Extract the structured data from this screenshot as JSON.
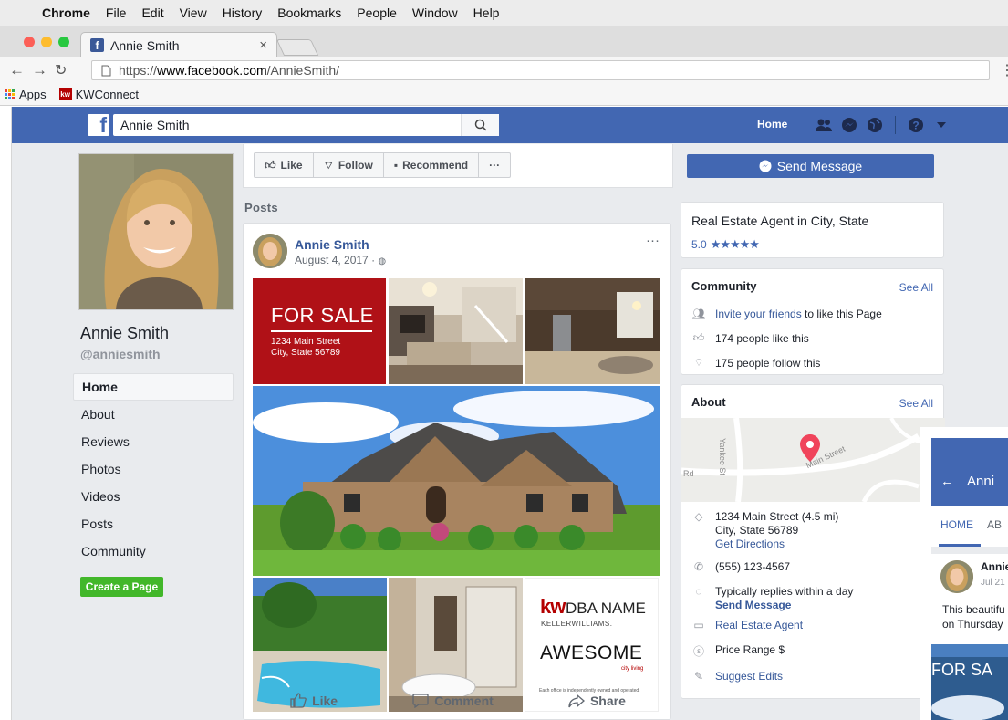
{
  "menubar": {
    "items": [
      "Chrome",
      "File",
      "Edit",
      "View",
      "History",
      "Bookmarks",
      "People",
      "Window",
      "Help"
    ]
  },
  "browser": {
    "tab_title": "Annie Smith",
    "url_prefix": "https://",
    "url_host": "www.facebook.com",
    "url_path": "/AnnieSmith/",
    "bookmarks": [
      "Apps",
      "KWConnect"
    ]
  },
  "fb_header": {
    "search_value": "Annie Smith",
    "home_label": "Home"
  },
  "profile": {
    "name": "Annie Smith",
    "handle": "@anniesmith",
    "nav": [
      "Home",
      "About",
      "Reviews",
      "Photos",
      "Videos",
      "Posts",
      "Community"
    ],
    "active_nav": "Home",
    "create_page": "Create a Page"
  },
  "actions": {
    "like": "Like",
    "follow": "Follow",
    "recommend": "Recommend",
    "more": "···",
    "send_message": "Send Message"
  },
  "posts_label": "Posts",
  "post": {
    "author": "Annie Smith",
    "date": "August 4, 2017 · ",
    "more": "···",
    "for_sale": "FOR SALE",
    "address_line1": "1234 Main Street",
    "address_line2": "City, State 56789",
    "brand_kw": "kw",
    "brand_dba": "DBA NAME",
    "brand_keller": "KELLERWILLIAMS.",
    "brand_awesome": "AWESOME",
    "brand_cityliving": "city living",
    "brand_disclaimer": "Each office is independently owned and operated.",
    "like": "Like",
    "comment": "Comment",
    "share": "Share"
  },
  "info_card": {
    "title": "Real Estate Agent in City, State",
    "rating": "5.0",
    "stars": "★★★★★"
  },
  "community": {
    "title": "Community",
    "see_all": "See All",
    "invite_link": "Invite your friends",
    "invite_rest": " to like this Page",
    "likes": "174 people like this",
    "follows": "175 people follow this"
  },
  "about": {
    "title": "About",
    "see_all": "See All",
    "map_road1": "Yankee St",
    "map_road2": "Main Street",
    "map_road3": "Rd",
    "address1": "1234 Main Street (4.5 mi)",
    "address2": "City, State 56789",
    "directions": "Get Directions",
    "phone": "(555) 123-4567",
    "replies": "Typically replies within a day",
    "send_message": "Send Message",
    "category": "Real Estate Agent",
    "price": "Price Range $",
    "suggest": "Suggest Edits"
  },
  "mobile": {
    "header_name": "Anni",
    "tab_home": "HOME",
    "tab_about": "AB",
    "post_name": "Annie",
    "post_date": "Jul 21",
    "text_line1": "This beautifu",
    "text_line2": "on Thursday",
    "for_sale": "FOR SA"
  },
  "colors": {
    "fb_blue": "#4267b2",
    "link": "#365899",
    "for_sale_red": "#b01117",
    "create_green": "#42b72a"
  }
}
